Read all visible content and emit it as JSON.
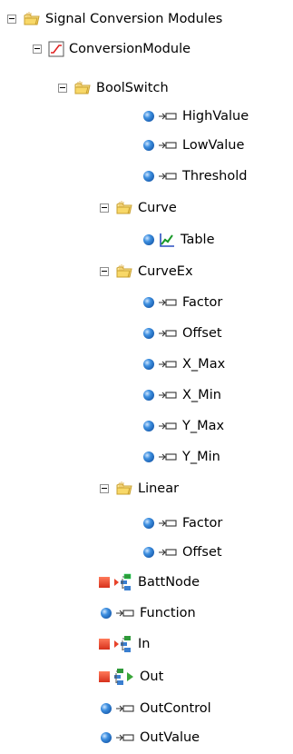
{
  "tree": {
    "root": {
      "label": "Signal Conversion Modules",
      "icon": "folder-icon",
      "module": {
        "label": "ConversionModule",
        "icon": "curve-module-icon",
        "folders": [
          {
            "label": "BoolSwitch",
            "icon": "folder-icon",
            "items": [
              {
                "label": "HighValue",
                "icon": "parameter-icon"
              },
              {
                "label": "LowValue",
                "icon": "parameter-icon"
              },
              {
                "label": "Threshold",
                "icon": "parameter-icon"
              }
            ]
          },
          {
            "label": "Curve",
            "icon": "folder-icon",
            "items": [
              {
                "label": "Table",
                "icon": "table-chart-icon"
              }
            ]
          },
          {
            "label": "CurveEx",
            "icon": "folder-icon",
            "items": [
              {
                "label": "Factor",
                "icon": "parameter-icon"
              },
              {
                "label": "Offset",
                "icon": "parameter-icon"
              },
              {
                "label": "X_Max",
                "icon": "parameter-icon"
              },
              {
                "label": "X_Min",
                "icon": "parameter-icon"
              },
              {
                "label": "Y_Max",
                "icon": "parameter-icon"
              },
              {
                "label": "Y_Min",
                "icon": "parameter-icon"
              }
            ]
          },
          {
            "label": "Linear",
            "icon": "folder-icon",
            "items": [
              {
                "label": "Factor",
                "icon": "parameter-icon"
              },
              {
                "label": "Offset",
                "icon": "parameter-icon"
              }
            ]
          }
        ],
        "signals": [
          {
            "label": "BattNode",
            "icon": "input-node-icon"
          },
          {
            "label": "Function",
            "icon": "parameter-icon"
          },
          {
            "label": "In",
            "icon": "input-node-icon"
          },
          {
            "label": "Out",
            "icon": "output-node-icon"
          },
          {
            "label": "OutControl",
            "icon": "parameter-icon"
          },
          {
            "label": "OutValue",
            "icon": "parameter-icon"
          }
        ]
      }
    }
  },
  "colors": {
    "folder": "#f5d060",
    "sphere": "#2f7fd6",
    "input_node": "#e8432a",
    "output_arrow": "#3aa63a",
    "expander_border": "#8f8f8f"
  }
}
